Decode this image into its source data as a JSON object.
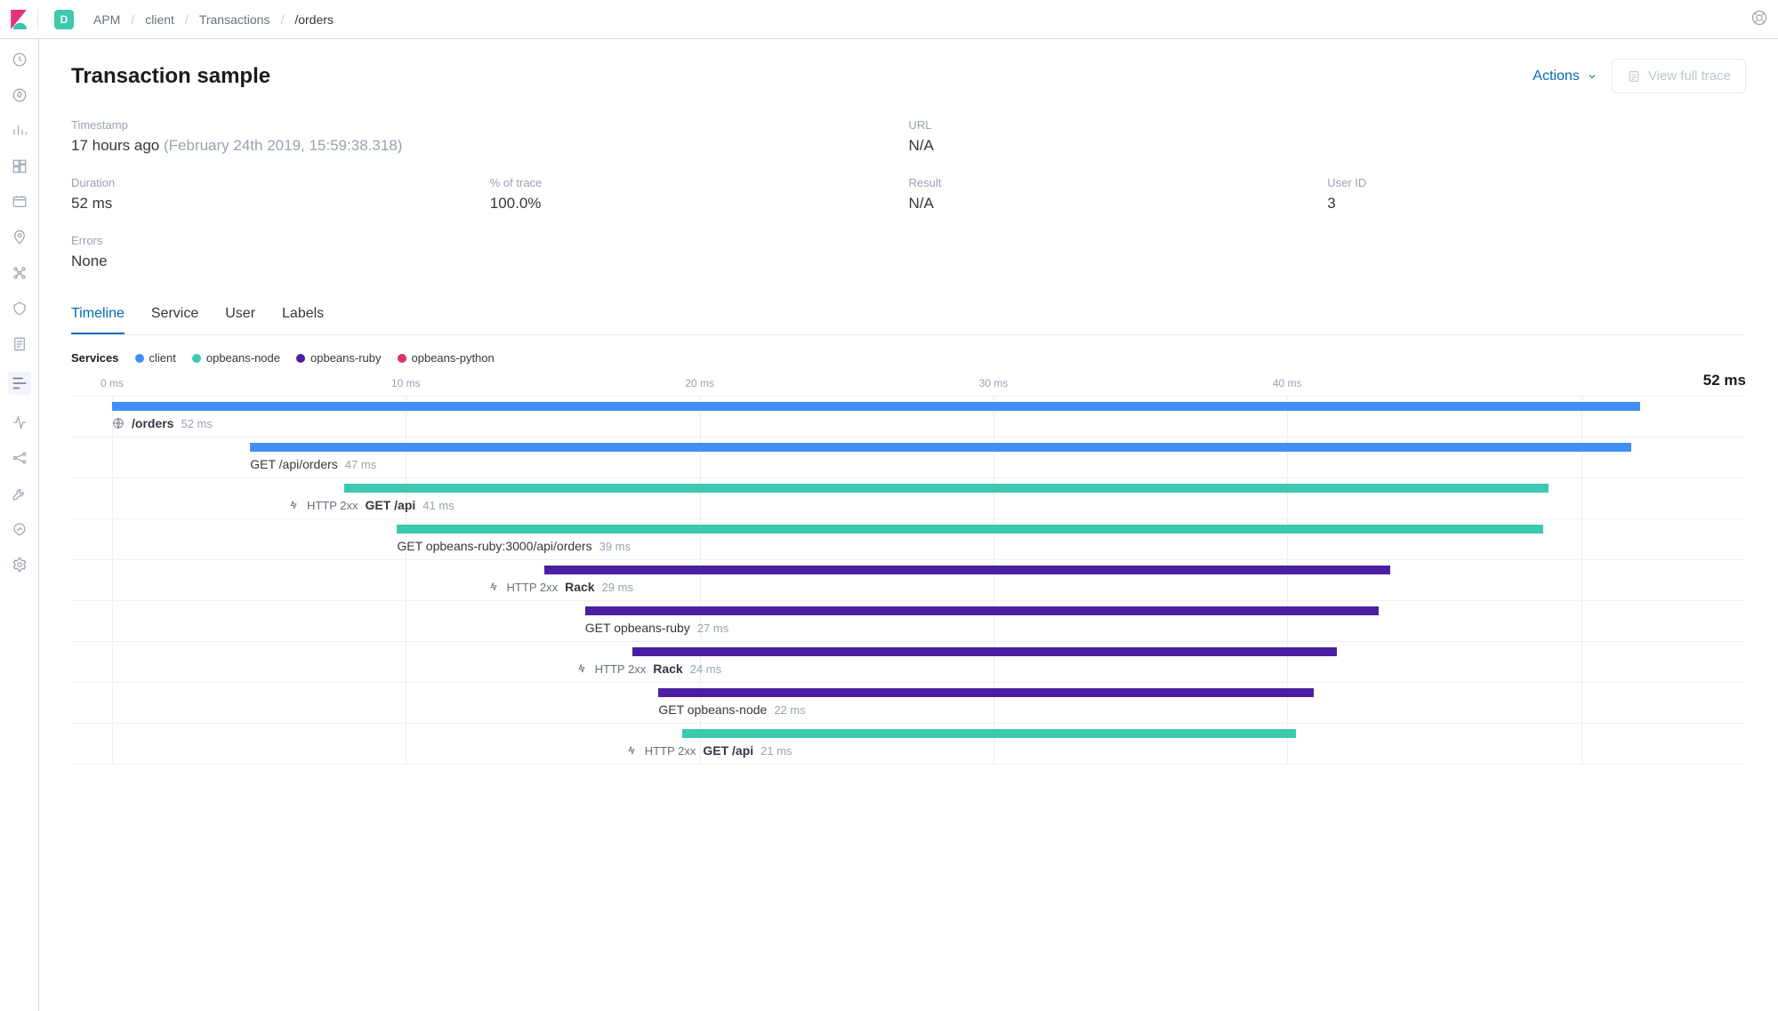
{
  "space_badge": "D",
  "breadcrumbs": [
    "APM",
    "client",
    "Transactions",
    "/orders"
  ],
  "page_title": "Transaction sample",
  "actions_label": "Actions",
  "view_full_trace_label": "View full trace",
  "meta": {
    "timestamp_label": "Timestamp",
    "timestamp_rel": "17 hours ago",
    "timestamp_abs": "(February 24th 2019, 15:59:38.318)",
    "url_label": "URL",
    "url_value": "N/A",
    "duration_label": "Duration",
    "duration_value": "52 ms",
    "pct_label": "% of trace",
    "pct_value": "100.0%",
    "result_label": "Result",
    "result_value": "N/A",
    "userid_label": "User ID",
    "userid_value": "3",
    "errors_label": "Errors",
    "errors_value": "None"
  },
  "tabs": [
    "Timeline",
    "Service",
    "User",
    "Labels"
  ],
  "tabs_active_index": 0,
  "legend_label": "Services",
  "legend": [
    {
      "name": "client",
      "color": "#3f8ff7"
    },
    {
      "name": "opbeans-node",
      "color": "#3dc9b0"
    },
    {
      "name": "opbeans-ruby",
      "color": "#4b1fa3"
    },
    {
      "name": "opbeans-python",
      "color": "#d6336c"
    }
  ],
  "axis": {
    "ticks": [
      "0 ms",
      "10 ms",
      "20 ms",
      "30 ms",
      "40 ms"
    ],
    "total": "52 ms",
    "max_ms": 52
  },
  "spans": [
    {
      "service": "client",
      "icon": "globe",
      "bold": true,
      "name": "/orders",
      "dur": "52 ms",
      "start_ms": 0,
      "len_ms": 52
    },
    {
      "service": "client",
      "icon": null,
      "bold": false,
      "name": "GET /api/orders",
      "dur": "47 ms",
      "start_ms": 4.7,
      "len_ms": 47
    },
    {
      "service": "node",
      "icon": "zap",
      "bold": true,
      "badge": "HTTP 2xx",
      "name": "GET /api",
      "dur": "41 ms",
      "start_ms": 7.9,
      "len_ms": 41
    },
    {
      "service": "node",
      "icon": null,
      "bold": false,
      "name": "GET opbeans-ruby:3000/api/orders",
      "dur": "39 ms",
      "start_ms": 9.7,
      "len_ms": 39
    },
    {
      "service": "ruby",
      "icon": "zap",
      "bold": true,
      "badge": "HTTP 2xx",
      "name": "Rack",
      "dur": "29 ms",
      "start_ms": 14.7,
      "len_ms": 28.8
    },
    {
      "service": "ruby",
      "icon": null,
      "bold": false,
      "name": "GET opbeans-ruby",
      "dur": "27 ms",
      "start_ms": 16.1,
      "len_ms": 27
    },
    {
      "service": "ruby",
      "icon": "zap",
      "bold": true,
      "badge": "HTTP 2xx",
      "name": "Rack",
      "dur": "24 ms",
      "start_ms": 17.7,
      "len_ms": 24
    },
    {
      "service": "ruby",
      "icon": null,
      "bold": false,
      "name": "GET opbeans-node",
      "dur": "22 ms",
      "start_ms": 18.6,
      "len_ms": 22.3
    },
    {
      "service": "node",
      "icon": "zap",
      "bold": true,
      "badge": "HTTP 2xx",
      "name": "GET /api",
      "dur": "21 ms",
      "start_ms": 19.4,
      "len_ms": 20.9
    }
  ]
}
